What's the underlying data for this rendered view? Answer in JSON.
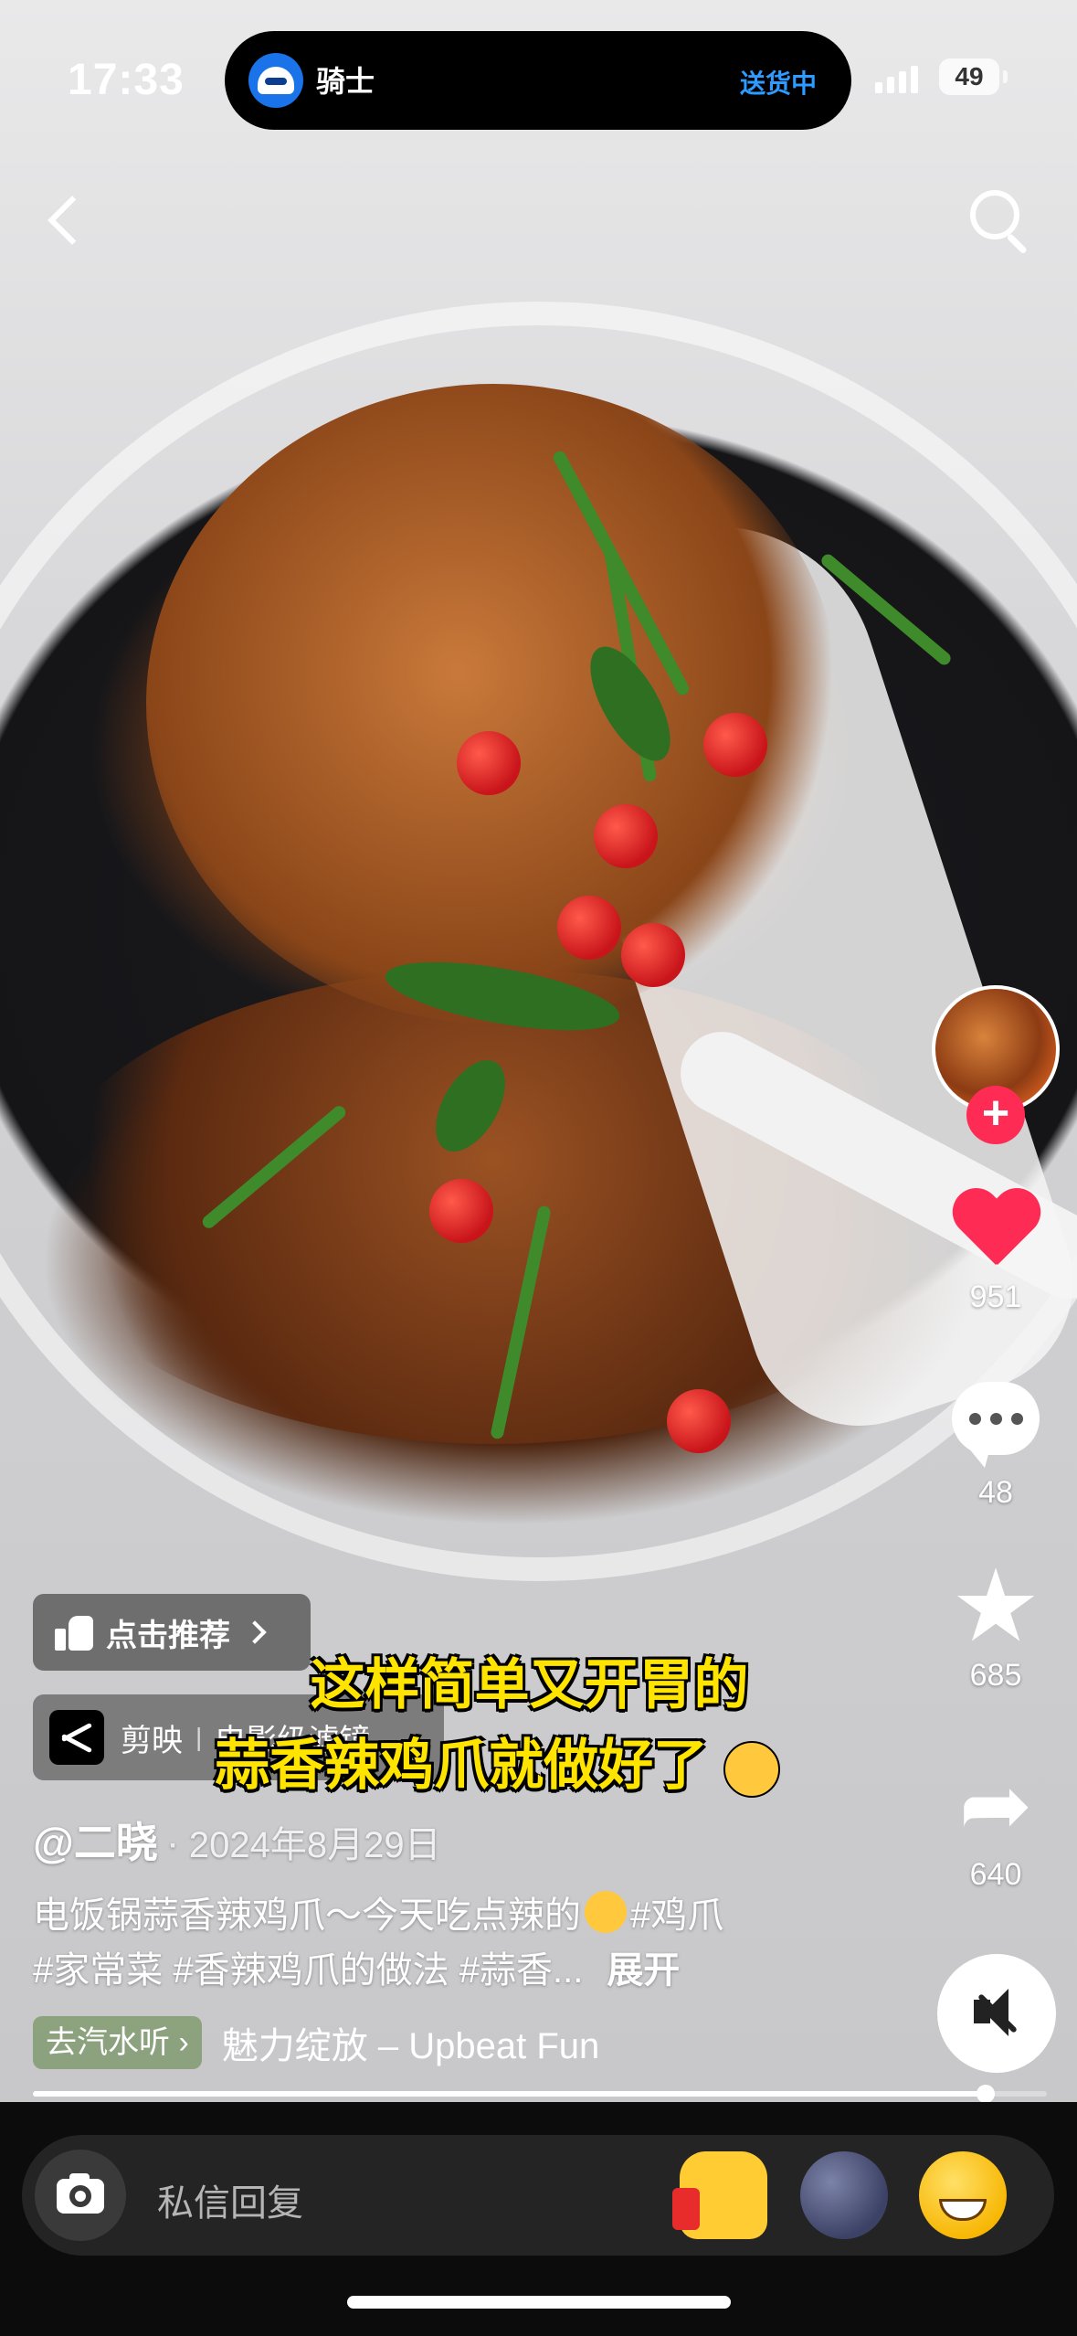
{
  "status_bar": {
    "time": "17:33",
    "island_title": "骑士",
    "island_status": "送货中",
    "battery": "49"
  },
  "rail": {
    "likes": "951",
    "comments": "48",
    "favorites": "685",
    "shares": "640"
  },
  "overlay": {
    "recommend_label": "点击推荐",
    "capcut_app": "剪映",
    "capcut_separator": "|",
    "capcut_template": "电影级滤镜",
    "subtitle_line1": "这样简单又开胃的",
    "subtitle_line2": "蒜香辣鸡爪就做好了"
  },
  "post": {
    "author": "@二晓",
    "date": "2024年8月29日",
    "desc_line1_a": "电饭锅蒜香辣鸡爪～今天吃点辣的",
    "desc_line1_b": "#鸡爪",
    "desc_line2": "#家常菜 #香辣鸡爪的做法 #蒜香...",
    "expand": "展开",
    "music_chip": "去汽水听",
    "music_title": "魅力绽放 – Upbeat Fun",
    "progress": 0.94
  },
  "reply": {
    "placeholder": "私信回复"
  },
  "colors": {
    "accent": "#fe2c55",
    "island_status": "#2d9bff",
    "subtitle": "#ffe400"
  },
  "icons": [
    "back-icon",
    "search-icon",
    "follow-plus-icon",
    "heart-icon",
    "comment-icon",
    "star-icon",
    "share-icon",
    "mute-icon",
    "thumbs-up-icon",
    "capcut-icon",
    "camera-icon",
    "thumbs-up-emoji",
    "moon-face-emoji",
    "grin-emoji"
  ]
}
